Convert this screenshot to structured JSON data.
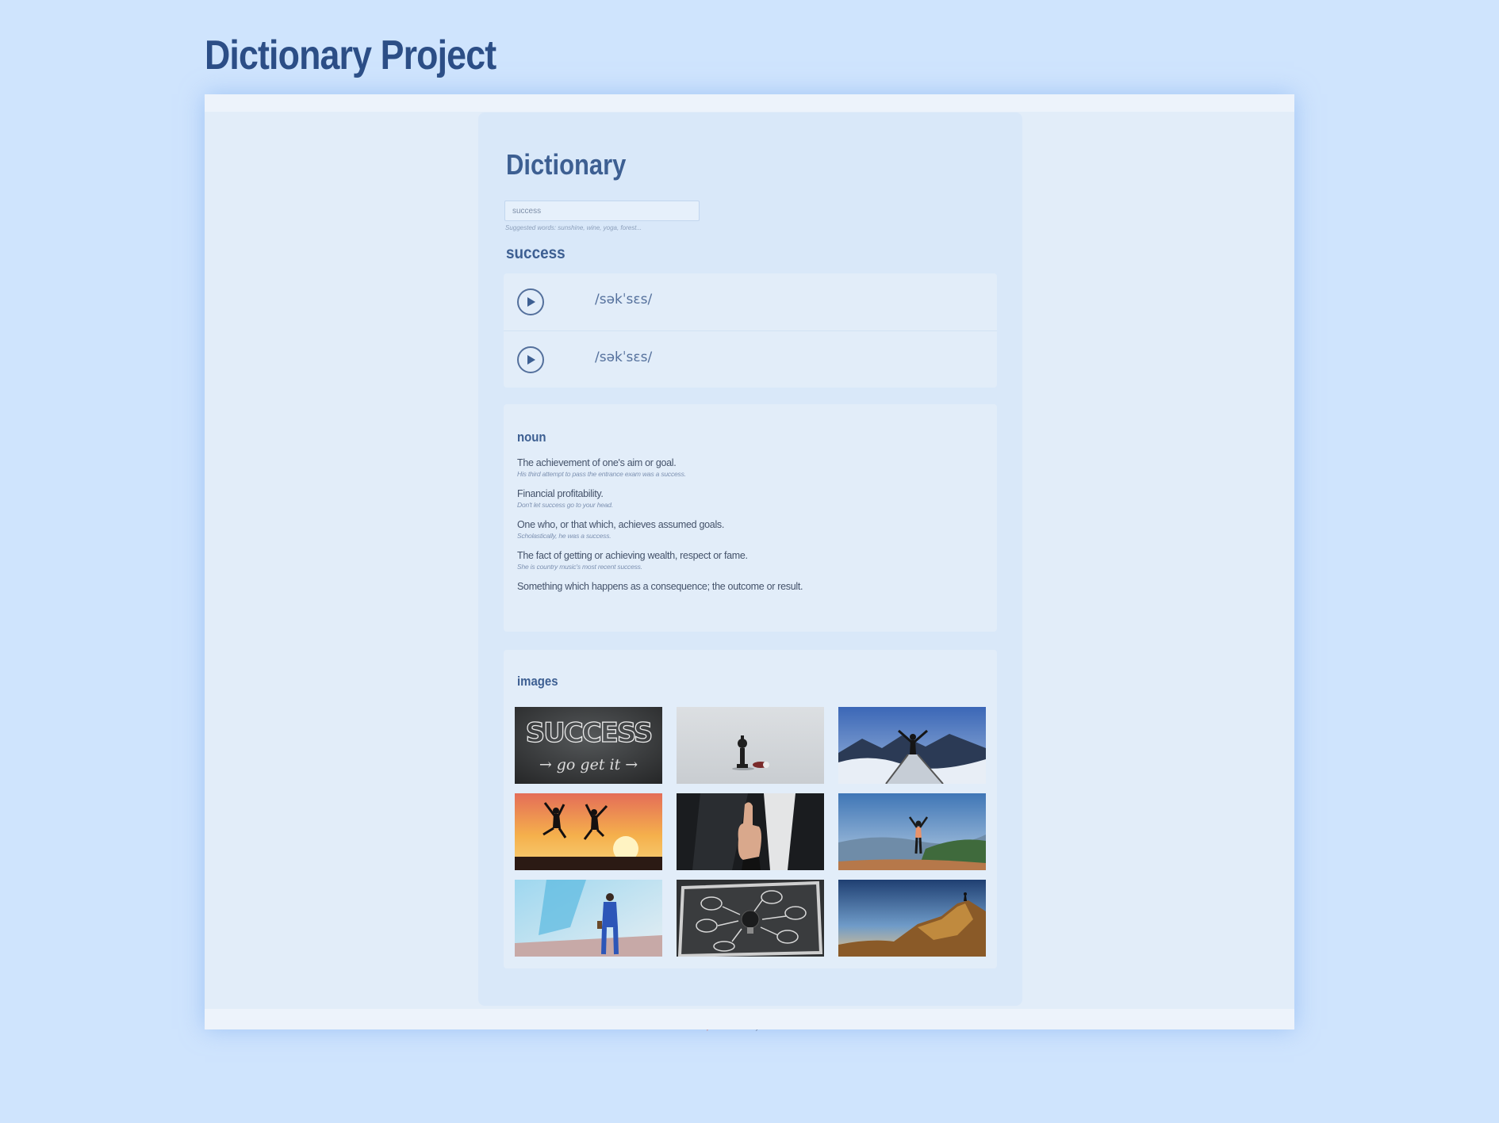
{
  "page": {
    "title": "Dictionary Project"
  },
  "app": {
    "heading": "Dictionary",
    "search": {
      "value": "success",
      "suggested": "Suggested words: sunshine, wine, yoga, forest..."
    },
    "word": "success",
    "phonetics": [
      {
        "text": "/səkˈsɛs/",
        "icon": "play-icon"
      },
      {
        "text": "/səkˈsɛs/",
        "icon": "play-icon"
      }
    ],
    "meaning": {
      "part_of_speech": "noun",
      "definitions": [
        {
          "definition": "The achievement of one's aim or goal.",
          "example": "His third attempt to pass the entrance exam was a success."
        },
        {
          "definition": "Financial profitability.",
          "example": "Don't let success go to your head."
        },
        {
          "definition": "One who, or that which, achieves assumed goals.",
          "example": "Scholastically, he was a success."
        },
        {
          "definition": "The fact of getting or achieving wealth, respect or fame.",
          "example": "She is country music's most recent success."
        },
        {
          "definition": "Something which happens as a consequence; the outcome or result.",
          "example": ""
        }
      ]
    },
    "images": {
      "heading": "images",
      "items": [
        {
          "name": "success-chalkboard-image",
          "text": "SUCCESS",
          "subtext": "→ go get it →"
        },
        {
          "name": "chess-pieces-image"
        },
        {
          "name": "mountain-bridge-image"
        },
        {
          "name": "sunset-jump-image"
        },
        {
          "name": "thumbs-up-image"
        },
        {
          "name": "mountain-peak-person-image"
        },
        {
          "name": "businessman-image"
        },
        {
          "name": "lightbulb-chalkboard-image"
        },
        {
          "name": "rock-summit-image"
        }
      ]
    },
    "footer": {
      "link": "Open source code",
      "author": " by Nicole Serban"
    }
  },
  "colors": {
    "background": "#cfe4fd",
    "title": "#2c4e86",
    "heading": "#3d5f92",
    "card": "#d9e8f9",
    "section": "#e2edf9",
    "footer_link": "#e0604a"
  }
}
